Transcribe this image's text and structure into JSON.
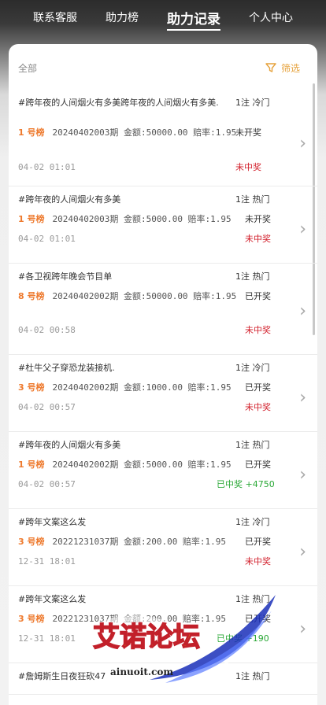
{
  "tabs": [
    "联系客服",
    "助力榜",
    "助力记录",
    "个人中心"
  ],
  "filter": {
    "all_label": "全部",
    "filter_label": "筛选"
  },
  "records": [
    {
      "title": "#跨年夜的人间烟火有多美跨年夜的人间烟火有多美.",
      "type": "1注 冷门",
      "rank": "1 号榜",
      "info": "20240402003期 金额:50000.00 赔率:1.95",
      "open": "未开奖",
      "time": "04-02 01:01",
      "result": "未中奖"
    },
    {
      "title": "#跨年夜的人间烟火有多美",
      "type": "1注 热门",
      "rank": "1 号榜",
      "info": "20240402003期 金额:5000.00 赔率:1.95",
      "open": "未开奖",
      "time": "04-02 01:01",
      "result": "未中奖"
    },
    {
      "title": "#各卫视跨年晚会节目单",
      "type": "1注 热门",
      "rank": "8 号榜",
      "info": "20240402002期 金额:50000.00 赔率:1.95",
      "open": "已开奖",
      "time": "04-02 00:58",
      "result": "未中奖"
    },
    {
      "title": "#杜牛父子穿恐龙装接机.",
      "type": "1注 冷门",
      "rank": "3 号榜",
      "info": "20240402002期 金额:1000.00 赔率:1.95",
      "open": "已开奖",
      "time": "04-02 00:57",
      "result": "未中奖"
    },
    {
      "title": "#跨年夜的人间烟火有多美",
      "type": "1注 热门",
      "rank": "1 号榜",
      "info": "20240402002期 金额:5000.00 赔率:1.95",
      "open": "已开奖",
      "time": "04-02 00:57",
      "result": "已中奖 +4750"
    },
    {
      "title": "#跨年文案这么发",
      "type": "1注 冷门",
      "rank": "3 号榜",
      "info": "20221231037期 金额:200.00 赔率:1.95",
      "open": "已开奖",
      "time": "12-31 18:01",
      "result": "未中奖"
    },
    {
      "title": "#跨年文案这么发",
      "type": "1注 热门",
      "rank": "3 号榜",
      "info": "20221231037期 金额:200.00 赔率:1.95",
      "open": "已开奖",
      "time": "12-31 18:01",
      "result": "已中奖 +190"
    },
    {
      "title": "#詹姆斯生日夜狂砍47",
      "type": "1注 热门",
      "rank": "",
      "info": "",
      "open": "",
      "time": "",
      "result": ""
    }
  ],
  "watermark": {
    "text": "艾诺论坛",
    "url": "ainuoit.com"
  },
  "colors": {
    "rank": "#ee7a2e",
    "win": "#2aa836",
    "lose": "#d21f2b",
    "filter": "#e6a23c"
  }
}
